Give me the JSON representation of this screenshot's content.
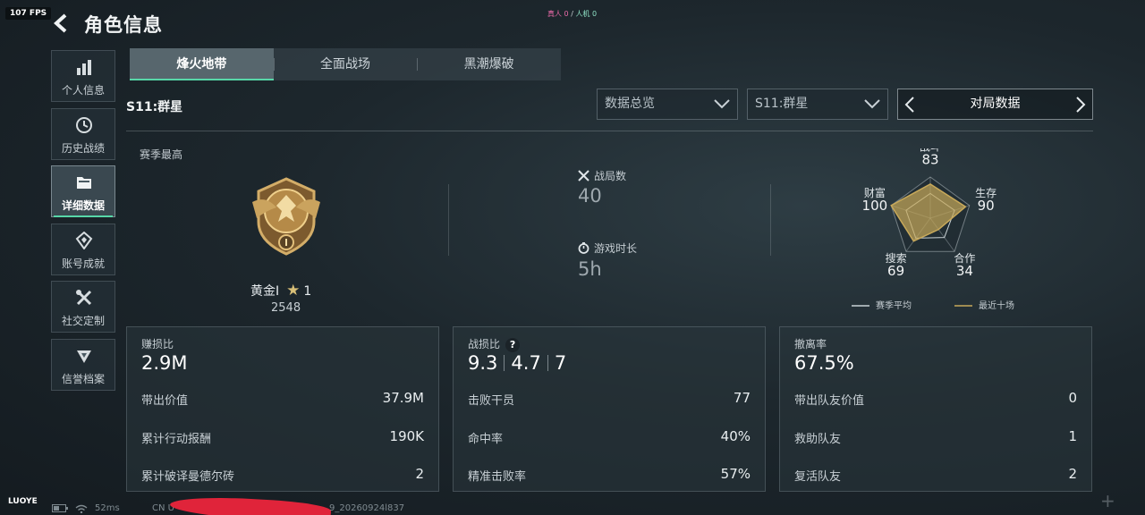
{
  "hud": {
    "fps": "107 FPS",
    "real_players": "真人 0",
    "sep": "/",
    "bot_players": "人机 0"
  },
  "header": {
    "title": "角色信息"
  },
  "sidebar": {
    "items": [
      {
        "label": "个人信息",
        "icon": "bar-chart-icon"
      },
      {
        "label": "历史战绩",
        "icon": "history-icon"
      },
      {
        "label": "详细数据",
        "icon": "folder-icon",
        "active": true
      },
      {
        "label": "账号成就",
        "icon": "achievement-icon"
      },
      {
        "label": "社交定制",
        "icon": "tools-icon"
      },
      {
        "label": "信誉档案",
        "icon": "reputation-icon"
      }
    ]
  },
  "tabs": [
    {
      "label": "烽火地带",
      "active": true
    },
    {
      "label": "全面战场"
    },
    {
      "label": "黑潮爆破"
    }
  ],
  "season_title": "S11:群星",
  "filters": {
    "overview": "数据总览",
    "season": "S11:群星",
    "mode": "对局数据"
  },
  "overview": {
    "highest_label": "赛季最高",
    "rank_name": "黄金I",
    "stars": "1",
    "rank_score": "2548",
    "matches_label": "战局数",
    "matches_value": "40",
    "playtime_label": "游戏时长",
    "playtime_value": "5h"
  },
  "radar": {
    "axes": [
      {
        "label": "战斗",
        "value": "83",
        "num": 83
      },
      {
        "label": "生存",
        "value": "90",
        "num": 90
      },
      {
        "label": "合作",
        "value": "34",
        "num": 34
      },
      {
        "label": "搜索",
        "value": "69",
        "num": 69
      },
      {
        "label": "财富",
        "value": "100",
        "num": 100
      }
    ],
    "season_avg": [
      60,
      62,
      58,
      60,
      62
    ],
    "legend_avg": "赛季平均",
    "legend_recent": "最近十场",
    "colors": {
      "avg": "#c9d2d6",
      "recent": "#c8a95a"
    }
  },
  "cards": {
    "profit": {
      "label": "赚损比",
      "value": "2.9M",
      "rows": [
        {
          "label": "带出价值",
          "value": "37.9M"
        },
        {
          "label": "累计行动报酬",
          "value": "190K"
        },
        {
          "label": "累计破译曼德尔砖",
          "value": "2"
        }
      ]
    },
    "combat": {
      "label": "战损比",
      "help": "?",
      "kd": [
        "9.3",
        "4.7",
        "7"
      ],
      "rows": [
        {
          "label": "击败干员",
          "value": "77"
        },
        {
          "label": "命中率",
          "value": "40%"
        },
        {
          "label": "精准击败率",
          "value": "57%"
        }
      ]
    },
    "extract": {
      "label": "撤离率",
      "value": "67.5%",
      "rows": [
        {
          "label": "带出队友价值",
          "value": "0"
        },
        {
          "label": "救助队友",
          "value": "1"
        },
        {
          "label": "复活队友",
          "value": "2"
        }
      ]
    }
  },
  "footer": {
    "user": "LUOYE",
    "ping": "52ms",
    "server": "CN U",
    "build": "9_20260924l837"
  }
}
